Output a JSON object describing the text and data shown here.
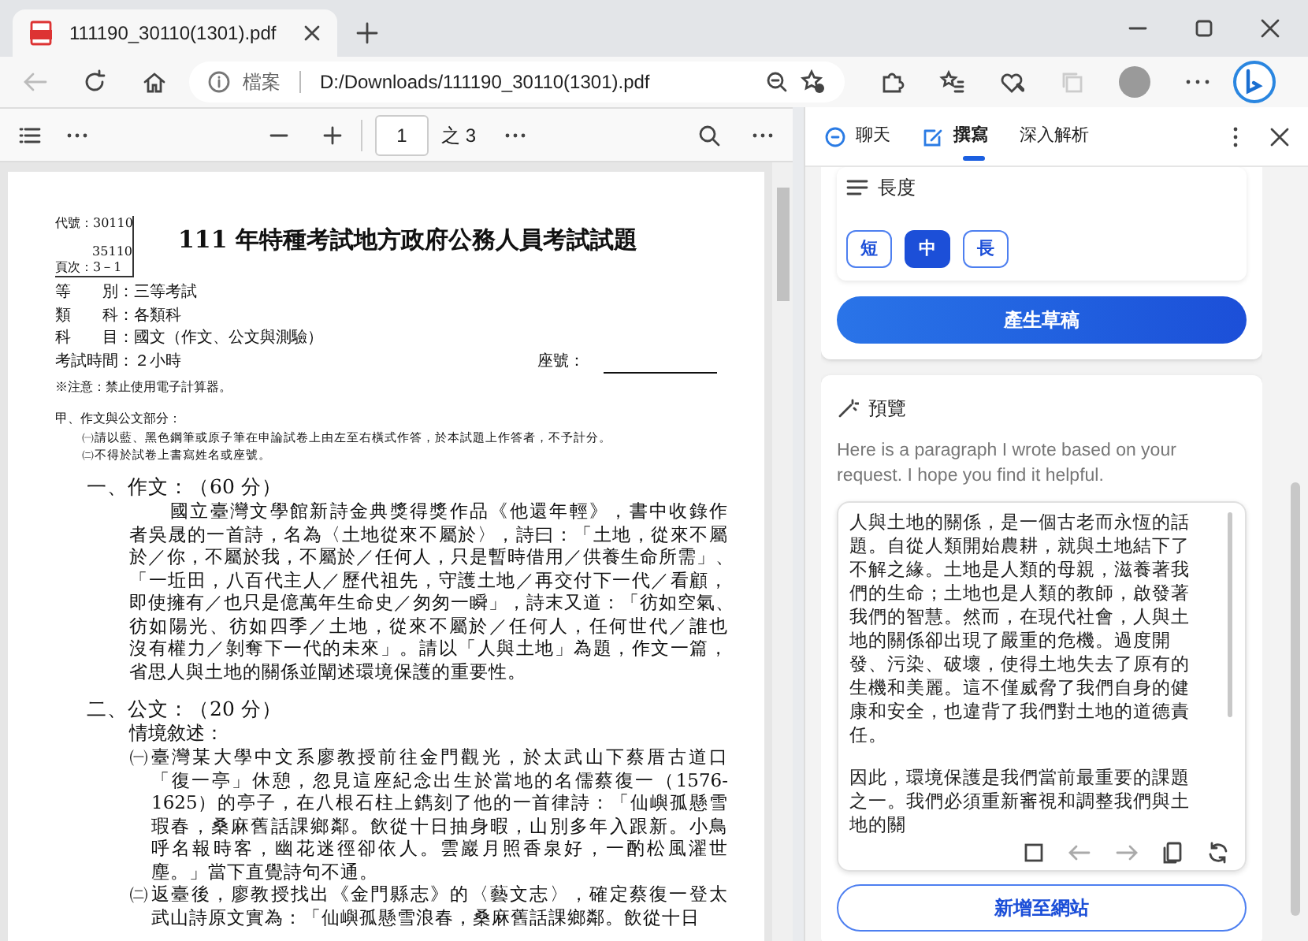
{
  "browser_tab": {
    "title": "111190_30110(1301).pdf"
  },
  "address_bar": {
    "label": "檔案",
    "url": "D:/Downloads/111190_30110(1301).pdf"
  },
  "pdf_toolbar": {
    "page": "1",
    "page_count": "之 3"
  },
  "document": {
    "code_lines": [
      "代號：30110",
      "35110",
      "頁次：3－1"
    ],
    "title": "111 年特種考試地方政府公務人員考試試題",
    "info": [
      "等　　別：三等考試",
      "類　　科：各類科",
      "科　　目：國文（作文、公文與測驗）",
      "考試時間：２小時"
    ],
    "seat_label": "座號：",
    "note": "※注意：禁止使用電子計算器。",
    "part": "甲、作文與公文部分：",
    "instructions": [
      "㈠請以藍、黑色鋼筆或原子筆在申論試卷上由左至右橫式作答，於本試題上作答者，不予計分。",
      "㈡不得於試卷上書寫姓名或座號。"
    ],
    "sections": [
      {
        "heading": "一、作文：（60 分）",
        "items": [
          {
            "lines": [
              "國立臺灣文學館新詩金典獎得獎作品《他還年輕》，書中收錄作",
              "者吳晟的一首詩，名為〈土地從來不屬於〉，詩曰：「土地，從來不屬",
              "於／你，不屬於我，不屬於／任何人，只是暫時借用／供養生命所需」、",
              "「一坵田，八百代主人／歷代祖先，守護土地／再交付下一代／看顧，",
              "即使擁有／也只是億萬年生命史／匆匆一瞬」，詩末又道：「彷如空氣、",
              "彷如陽光、彷如四季／土地，從來不屬於／任何人，任何世代／誰也",
              "沒有權力／剝奪下一代的未來」。請以「人與土地」為題，作文一篇，",
              "省思人與土地的關係並闡述環境保護的重要性。"
            ]
          }
        ]
      },
      {
        "heading": "二、公文：（20 分）",
        "subheading": "情境敘述：",
        "items": [
          {
            "mark": "㈠",
            "lines": [
              "臺灣某大學中文系廖教授前往金門觀光，於太武山下蔡厝古道口",
              "「復一亭」休憩，忽見這座紀念出生於當地的名儒蔡復一（1576-",
              "1625）的亭子，在八根石柱上鐫刻了他的一首律詩：「仙嶼孤懸雪",
              "瑕春，桑麻舊話課鄉鄰。飲從十日抽身暇，山別多年入跟新。小鳥",
              "呼名報時客，幽花迷徑卻依人。雲巖月照香泉好，一酌松風濯世",
              "塵。」當下直覺詩句不通。"
            ]
          },
          {
            "mark": "㈡",
            "lines": [
              "返臺後，廖教授找出《金門縣志》的〈藝文志〉，確定蔡復一登太",
              "武山詩原文實為：「仙嶼孤懸雪浪春，桑麻舊話課鄉鄰。飲從十日"
            ]
          }
        ]
      }
    ]
  },
  "sidebar": {
    "tabs": [
      {
        "label": "聊天",
        "kind": "chat",
        "selected": false
      },
      {
        "label": "撰寫",
        "kind": "compose",
        "selected": true
      },
      {
        "label": "深入解析",
        "kind": "insights",
        "selected": false
      }
    ],
    "length": {
      "label": "長度",
      "options": [
        {
          "label": "短",
          "selected": false
        },
        {
          "label": "中",
          "selected": true
        },
        {
          "label": "長",
          "selected": false
        }
      ]
    },
    "generate_button": "產生草稿",
    "preview": {
      "title": "預覽",
      "intro": "Here is a paragraph I wrote based on your request. I hope you find it helpful.",
      "paragraphs": [
        "人與土地的關係，是一個古老而永恆的話題。自從人類開始農耕，就與土地結下了不解之緣。土地是人類的母親，滋養著我們的生命；土地也是人類的教師，啟發著我們的智慧。然而，在現代社會，人與土地的關係卻出現了嚴重的危機。過度開發、污染、破壞，使得土地失去了原有的生機和美麗。這不僅威脅了我們自身的健康和安全，也違背了我們對土地的道德責任。",
        "因此，環境保護是我們當前最重要的課題之一。我們必須重新審視和調整我們與土地的關"
      ]
    },
    "add_button": "新增至網站"
  }
}
